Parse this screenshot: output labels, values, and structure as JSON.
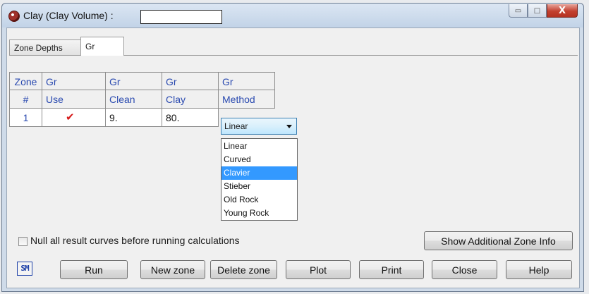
{
  "window": {
    "title": "Clay (Clay Volume) :",
    "title_field_value": "",
    "controls": {
      "minimize": "▭",
      "maximize": "□",
      "close": "X"
    }
  },
  "tabs": [
    {
      "label": "Zone Depths",
      "active": false
    },
    {
      "label": "Gr",
      "active": true
    }
  ],
  "grid": {
    "header_row1": [
      "Zone",
      "Gr",
      "Gr",
      "Gr",
      "Gr"
    ],
    "header_row2": [
      "#",
      "Use",
      "Clean",
      "Clay",
      "Method"
    ],
    "rows": [
      {
        "zone": "1",
        "use": "✔",
        "clean": "9.",
        "clay": "80.",
        "method": "Linear"
      }
    ]
  },
  "method_dropdown": {
    "selected": "Linear",
    "highlighted": "Clavier",
    "options": [
      "Linear",
      "Curved",
      "Clavier",
      "Stieber",
      "Old Rock",
      "Young Rock"
    ]
  },
  "footer": {
    "null_checkbox_label": "Null all result curves before running calculations",
    "null_checked": false,
    "show_info_label": "Show Additional Zone Info",
    "sm_icon_text": "SM",
    "buttons": [
      "Run",
      "New zone",
      "Delete zone",
      "Plot",
      "Print",
      "Close",
      "Help"
    ]
  },
  "colors": {
    "header_text": "#2a4ab0",
    "check": "#d61818",
    "highlight": "#3399ff"
  }
}
